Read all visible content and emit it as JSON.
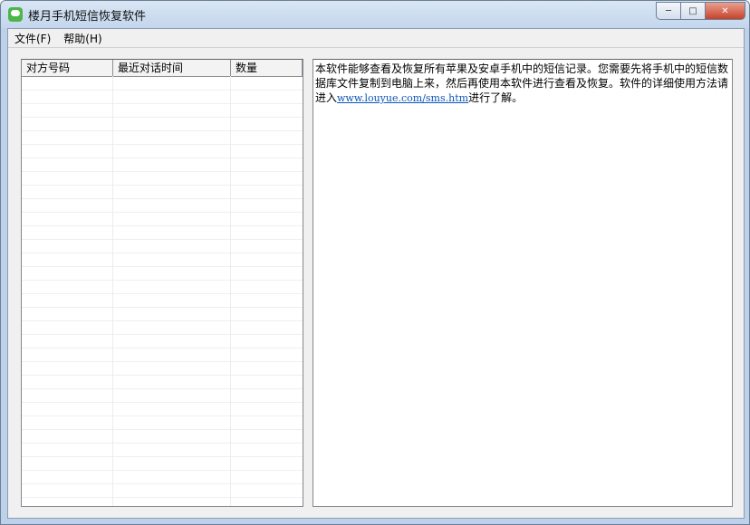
{
  "window": {
    "title": "楼月手机短信恢复软件",
    "buttons": {
      "minimize": "─",
      "maximize": "□",
      "close": "✕"
    }
  },
  "menu": [
    {
      "label": "文件(F)"
    },
    {
      "label": "帮助(H)"
    }
  ],
  "conversation_list": {
    "columns": [
      "对方号码",
      "最近对话时间",
      "数量"
    ]
  },
  "info": {
    "text_before": "本软件能够查看及恢复所有苹果及安卓手机中的短信记录。您需要先将手机中的短信数据库文件复制到电脑上来，然后再使用本软件进行查看及恢复。软件的详细使用方法请进入",
    "link": "www.louyue.com/sms.htm",
    "text_after": "进行了解。"
  }
}
